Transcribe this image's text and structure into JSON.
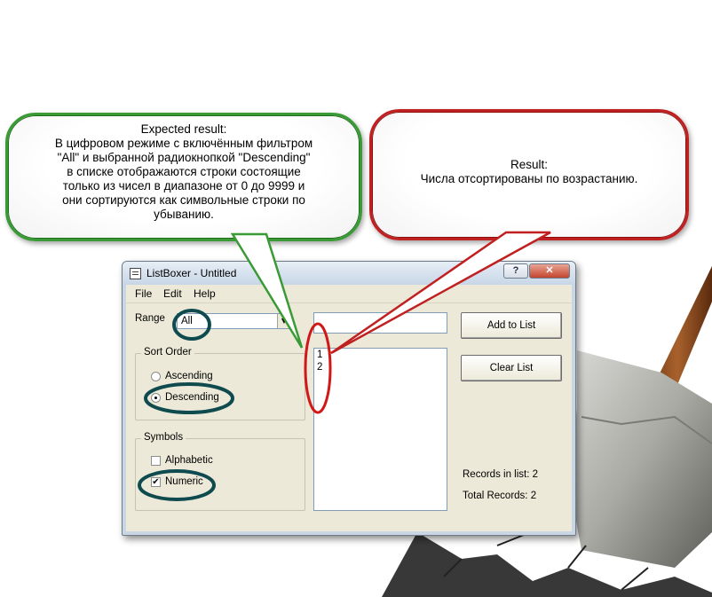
{
  "callouts": {
    "expected": {
      "title": "Expected result:",
      "lines": [
        "В цифровом режиме с включённым фильтром",
        "\"All\" и выбранной радиокнопкой \"Descending\"",
        "в списке отображаются строки состоящие",
        "только из чисел в диапазоне от 0 до 9999 и",
        "они сортируются как символьные строки по",
        "убыванию."
      ]
    },
    "result": {
      "title": "Result:",
      "text": "Числа отсортированы по возрастанию."
    }
  },
  "window": {
    "title": "ListBoxer - Untitled",
    "help_button": "?",
    "close_button": "✕"
  },
  "menu": {
    "file": "File",
    "edit": "Edit",
    "help": "Help"
  },
  "range": {
    "label": "Range",
    "value": "All"
  },
  "sort_order": {
    "title": "Sort Order",
    "ascending": "Ascending",
    "descending": "Descending",
    "selected": "Descending"
  },
  "symbols": {
    "title": "Symbols",
    "alphabetic": "Alphabetic",
    "alphabetic_checked": false,
    "numeric": "Numeric",
    "numeric_checked": true
  },
  "input": {
    "value": ""
  },
  "list": {
    "items": [
      "1",
      "2"
    ]
  },
  "buttons": {
    "add": "Add to List",
    "clear": "Clear List"
  },
  "stats": {
    "records_in_list": "Records in list: 2",
    "total_records": "Total Records: 2"
  },
  "colors": {
    "expected_border": "#3a9a35",
    "result_border": "#c02020",
    "marker_teal": "#0f4a4f",
    "marker_red": "#d01818"
  },
  "icons": {
    "checkmark": "✔",
    "dropdown": "▼"
  }
}
